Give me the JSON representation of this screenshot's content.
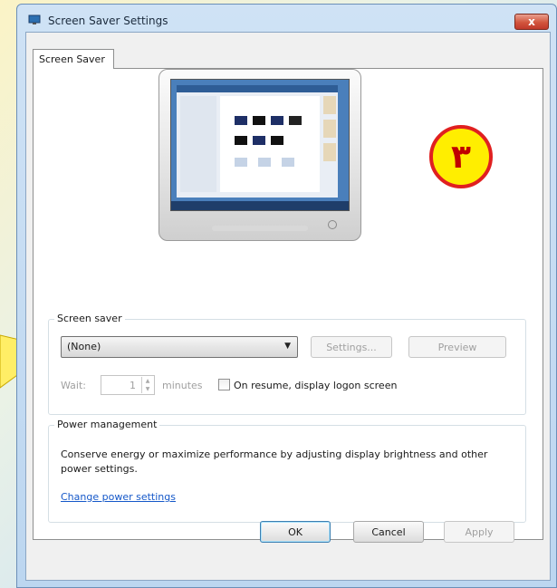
{
  "window": {
    "title": "Screen Saver Settings",
    "close_label": "x",
    "icon": "monitor-settings-icon"
  },
  "tabs": [
    {
      "label": "Screen Saver",
      "active": true
    }
  ],
  "badge": {
    "text": "٣",
    "color_fill": "#ffee00",
    "color_border": "#e02020"
  },
  "screen_saver": {
    "group_label": "Screen saver",
    "selected": "(None)",
    "settings_label": "Settings...",
    "preview_label": "Preview",
    "wait_label": "Wait:",
    "wait_value": "1",
    "minutes_label": "minutes",
    "resume_label": "On resume, display logon screen",
    "resume_checked": false
  },
  "power": {
    "group_label": "Power management",
    "description": "Conserve energy or maximize performance by adjusting display brightness and other power settings.",
    "link": "Change power settings"
  },
  "footer": {
    "ok": "OK",
    "cancel": "Cancel",
    "apply": "Apply"
  },
  "colors": {
    "link": "#1558c9",
    "disabled_text": "#a0a0a0"
  }
}
